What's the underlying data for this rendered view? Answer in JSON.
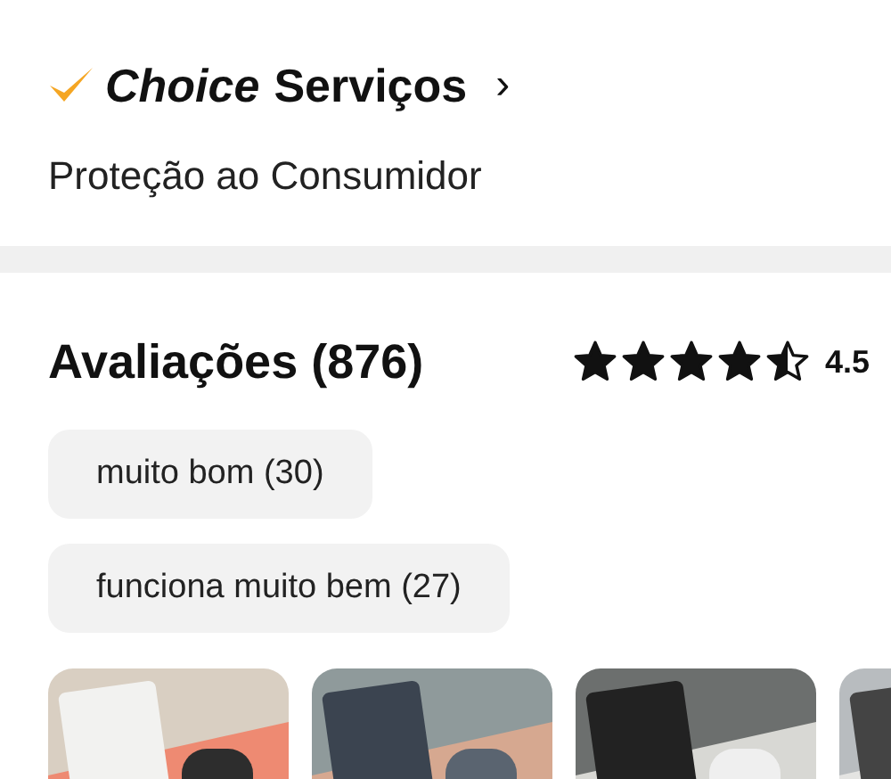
{
  "choice": {
    "brand": "Choice",
    "title": "Serviços",
    "chevron": "›",
    "subtitle": "Proteção ao Consumidor"
  },
  "reviews": {
    "heading": "Avaliações (876)",
    "stars": 4.5,
    "rating": "4.5",
    "tags": [
      {
        "label": "muito bom (30)"
      },
      {
        "label": "funciona muito bem (27)"
      }
    ],
    "photos": [
      {
        "kind": "picture"
      },
      {
        "kind": "picture"
      },
      {
        "kind": "picture"
      },
      {
        "kind": "picture"
      }
    ]
  }
}
